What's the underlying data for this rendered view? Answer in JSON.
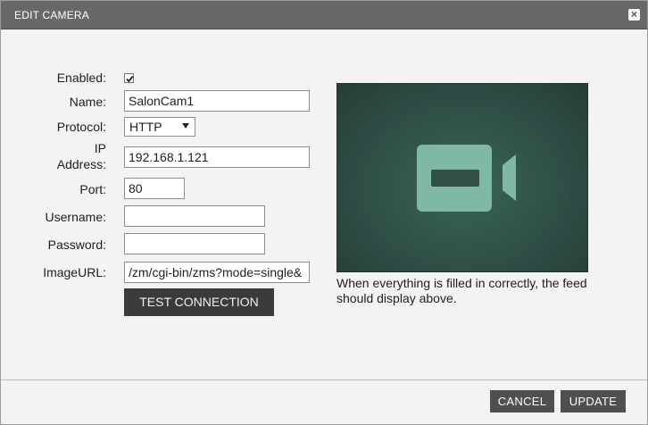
{
  "dialog": {
    "title": "EDIT CAMERA",
    "close_label": "×"
  },
  "form": {
    "enabled_label": "Enabled:",
    "enabled_checked": true,
    "name_label": "Name:",
    "name_value": "SalonCam1",
    "protocol_label": "Protocol:",
    "protocol_value": "HTTP",
    "ip_label_line1": "IP",
    "ip_label_line2": "Address:",
    "ip_value": "192.168.1.121",
    "port_label": "Port:",
    "port_value": "80",
    "username_label": "Username:",
    "username_value": "",
    "password_label": "Password:",
    "password_value": "",
    "imageurl_label": "ImageURL:",
    "imageurl_value": "/zm/cgi-bin/zms?mode=single&",
    "test_button": "TEST CONNECTION"
  },
  "preview": {
    "icon": "video-camera-icon",
    "hint": "When everything is filled in correctly, the feed should display above."
  },
  "footer": {
    "cancel_button": "CANCEL",
    "update_button": "UPDATE"
  },
  "colors": {
    "titlebar": "#686868",
    "preview_bg": "#2f4f47",
    "camera_icon": "#7fb8a6",
    "button_dark": "#3b3b3b"
  }
}
